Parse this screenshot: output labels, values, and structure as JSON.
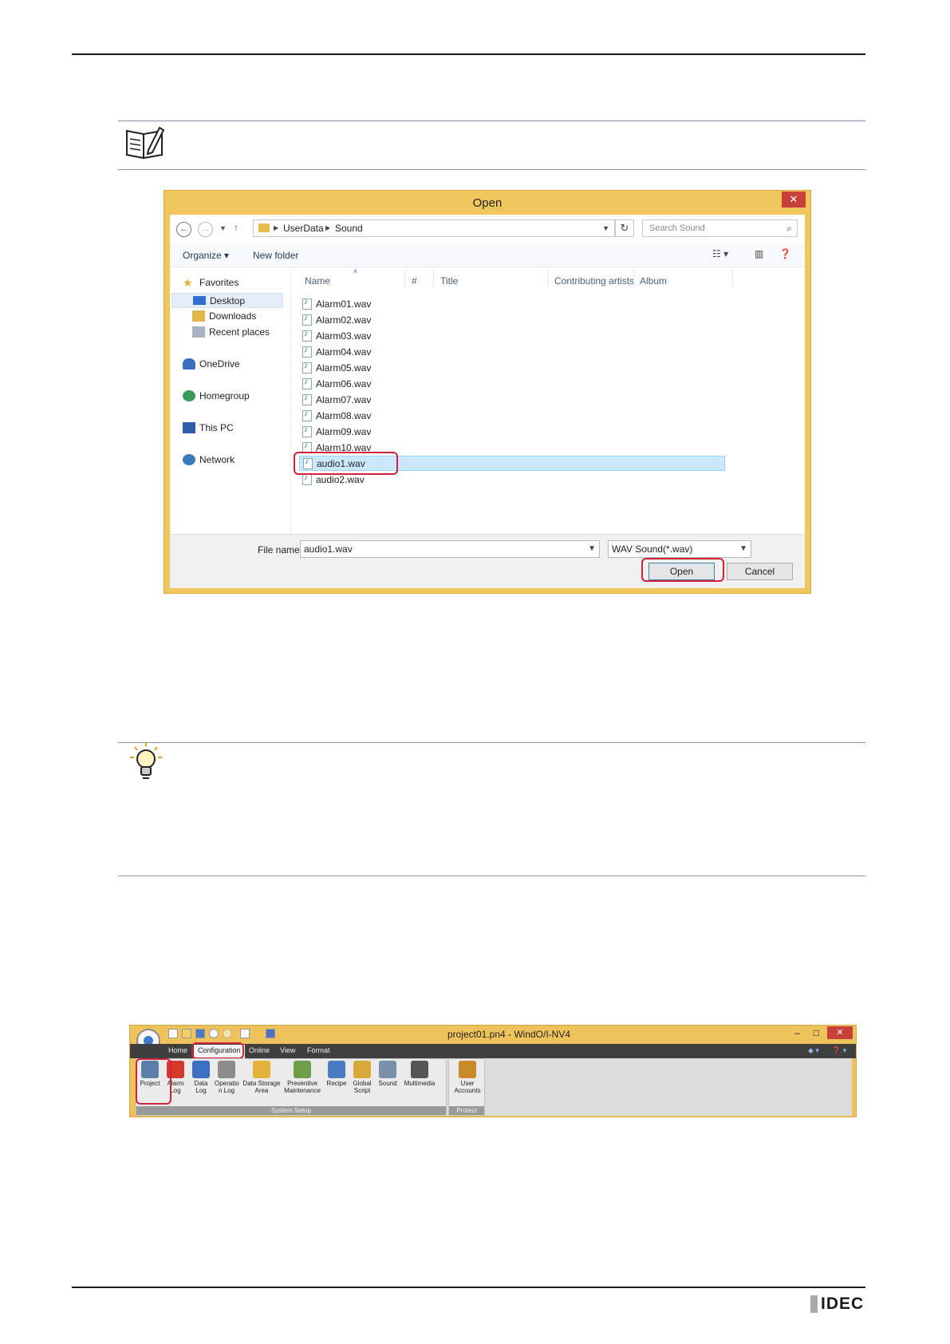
{
  "dialog": {
    "title": "Open",
    "close": "✕",
    "address": {
      "crumbs": [
        "UserData",
        "Sound"
      ],
      "search_placeholder": "Search Sound"
    },
    "toolbar": {
      "organize": "Organize ▾",
      "new_folder": "New folder"
    },
    "nav": [
      "Favorites",
      "Desktop",
      "Downloads",
      "Recent places",
      "OneDrive",
      "Homegroup",
      "This PC",
      "Network"
    ],
    "columns": [
      "Name",
      "#",
      "Title",
      "Contributing artists",
      "Album"
    ],
    "files": [
      "Alarm01.wav",
      "Alarm02.wav",
      "Alarm03.wav",
      "Alarm04.wav",
      "Alarm05.wav",
      "Alarm06.wav",
      "Alarm07.wav",
      "Alarm08.wav",
      "Alarm09.wav",
      "Alarm10.wav",
      "audio1.wav",
      "audio2.wav"
    ],
    "file_name_label": "File name:",
    "file_name_value": "audio1.wav",
    "file_type": "WAV Sound(*.wav)",
    "open_button": "Open",
    "cancel_button": "Cancel"
  },
  "ribbon": {
    "title": "project01.pn4 - WindO/I-NV4",
    "tabs": [
      "Home",
      "Configuration",
      "Online",
      "View",
      "Format"
    ],
    "buttons": [
      {
        "label": "Project",
        "icon": "project-icon",
        "color": "#5b7fa8"
      },
      {
        "label": "Alarm Log",
        "icon": "alarm-log-icon",
        "color": "#d33a2c"
      },
      {
        "label": "Data Log",
        "icon": "data-log-icon",
        "color": "#3a6fc2"
      },
      {
        "label": "Operatio n Log",
        "icon": "operation-log-icon",
        "color": "#8c8c8c"
      },
      {
        "label": "Data Storage Area",
        "icon": "data-storage-icon",
        "color": "#e2b23a"
      },
      {
        "label": "Preventive Maintenance",
        "icon": "maintenance-icon",
        "color": "#6f9e4a"
      },
      {
        "label": "Recipe",
        "icon": "recipe-icon",
        "color": "#4c7bc2"
      },
      {
        "label": "Global Script",
        "icon": "script-icon",
        "color": "#d9a83a"
      },
      {
        "label": "Sound",
        "icon": "sound-icon",
        "color": "#7a8fa8"
      },
      {
        "label": "Multimedia",
        "icon": "multimedia-icon",
        "color": "#555555"
      },
      {
        "label": "User Accounts",
        "icon": "user-accounts-icon",
        "color": "#c98a2a"
      }
    ],
    "group_system": "System Setup",
    "group_protect": "Protect"
  },
  "footer": {
    "logo": "IDEC"
  }
}
